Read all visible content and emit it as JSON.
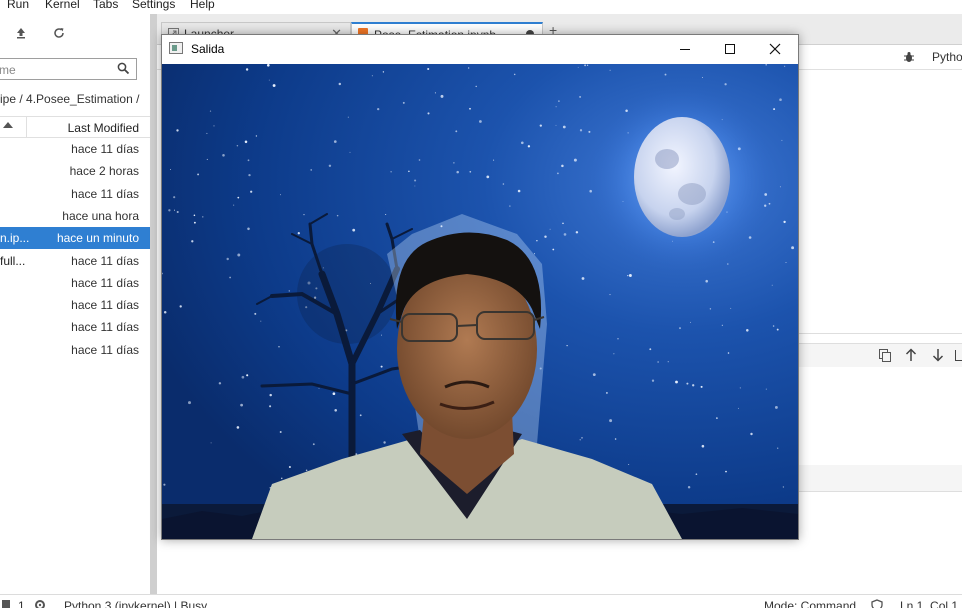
{
  "menubar": {
    "items": [
      "Run",
      "Kernel",
      "Tabs",
      "Settings",
      "Help"
    ]
  },
  "file_browser": {
    "filter_placeholder": "me",
    "breadcrumb": "ipe / 4.Posee_Estimation /",
    "column_last_modified": "Last Modified",
    "files": [
      {
        "name": "",
        "modified": "hace 11 días",
        "selected": false
      },
      {
        "name": "",
        "modified": "hace 2 horas",
        "selected": false
      },
      {
        "name": "",
        "modified": "hace 11 días",
        "selected": false
      },
      {
        "name": "",
        "modified": "hace una hora",
        "selected": false
      },
      {
        "name": "n.ip...",
        "modified": "hace un minuto",
        "selected": true
      },
      {
        "name": "full...",
        "modified": "hace 11 días",
        "selected": false
      },
      {
        "name": "",
        "modified": "hace 11 días",
        "selected": false
      },
      {
        "name": "",
        "modified": "hace 11 días",
        "selected": false
      },
      {
        "name": "",
        "modified": "hace 11 días",
        "selected": false
      },
      {
        "name": "",
        "modified": "hace 11 días",
        "selected": false
      }
    ]
  },
  "tabs": [
    {
      "label": "Launcher"
    },
    {
      "label": "Pose_Estimation.ipynb"
    }
  ],
  "notebook": {
    "kernel_name": "Pytho"
  },
  "cv_window": {
    "title": "Salida"
  },
  "statusbar": {
    "count": "1",
    "kernel_status": "Python 3 (ipykernel) | Busy",
    "mode": "Mode: Command",
    "position": "Ln 1, Col 1"
  },
  "colors": {
    "accent": "#2f7fd2",
    "night_sky": "#0e3f8c"
  }
}
